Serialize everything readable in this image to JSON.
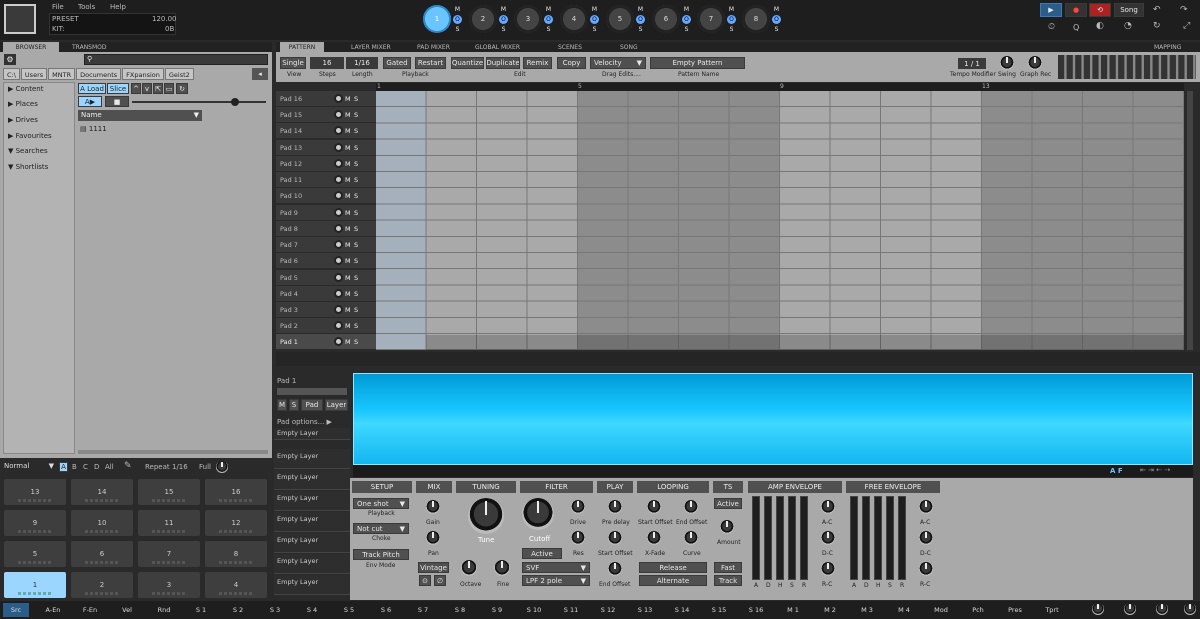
{
  "menu": {
    "file": "File",
    "tools": "Tools",
    "help": "Help"
  },
  "preset": {
    "preset_label": "PRESET",
    "preset_value": "120.00",
    "kit_label": "KIT:",
    "kit_value": "0B"
  },
  "sequences": [
    "1",
    "2",
    "3",
    "4",
    "5",
    "6",
    "7",
    "8"
  ],
  "mos": [
    "M",
    "O",
    "S"
  ],
  "transport": {
    "song": "Song",
    "q": "Q"
  },
  "browser": {
    "tabs": [
      "BROWSER",
      "TRANSMOD"
    ],
    "path": [
      "C:\\",
      "Users",
      "MNTR",
      "Documents",
      "FXpansion",
      "Geist2"
    ],
    "tree": [
      "Content",
      "Places",
      "Drives",
      "Favourites",
      "Searches",
      "Shortlists"
    ],
    "load": "A Load",
    "slice": "Slice",
    "a_btn": "A",
    "name_header": "Name",
    "file": "1111"
  },
  "pad_mode": {
    "mode": "Normal",
    "banks": [
      "A",
      "B",
      "C",
      "D",
      "All"
    ],
    "repeat_label": "Repeat",
    "repeat_value": "1/16",
    "full": "Full"
  },
  "pads": [
    [
      "13",
      "14",
      "15",
      "16"
    ],
    [
      "9",
      "10",
      "11",
      "12"
    ],
    [
      "5",
      "6",
      "7",
      "8"
    ],
    [
      "1",
      "2",
      "3",
      "4"
    ]
  ],
  "main_tabs": [
    "PATTERN",
    "LAYER MIXER",
    "PAD MIXER",
    "GLOBAL MIXER",
    "SCENES",
    "SONG",
    "MAPPING"
  ],
  "toolbar": {
    "single": "Single",
    "steps": "16",
    "length": "1/16",
    "gated": "Gated",
    "restart": "Restart",
    "quantize": "Quantize",
    "duplicate": "Duplicate",
    "remix": "Remix",
    "copy": "Copy",
    "velocity": "Velocity",
    "empty_pattern": "Empty Pattern",
    "tempo_value": "1 / 1",
    "sub_view": "View",
    "sub_steps": "Steps",
    "sub_length": "Length",
    "sub_playback": "Playback",
    "sub_edit": "Edit",
    "sub_drag": "Drag Edits....",
    "sub_pname": "Pattern Name",
    "sub_tempo": "Tempo Modifier",
    "sub_swing": "Swing",
    "sub_graph": "Graph Rec"
  },
  "ruler": [
    "1",
    "5",
    "9",
    "13"
  ],
  "pad_rows": [
    "Pad 16",
    "Pad 15",
    "Pad 14",
    "Pad 13",
    "Pad 12",
    "Pad 11",
    "Pad 10",
    "Pad 9",
    "Pad 8",
    "Pad 7",
    "Pad 6",
    "Pad 5",
    "Pad 4",
    "Pad 3",
    "Pad 2",
    "Pad 1"
  ],
  "pad_row_ms": {
    "m": "M",
    "s": "S"
  },
  "pad_panel": {
    "title": "Pad 1",
    "m": "M",
    "s": "S",
    "pad": "Pad",
    "layer": "Layer",
    "options": "Pad options...",
    "layers": [
      "Empty Layer",
      "Empty Layer",
      "Empty Layer",
      "Empty Layer",
      "Empty Layer",
      "Empty Layer",
      "Empty Layer",
      "Empty Layer"
    ]
  },
  "waveform": {
    "af": "A F"
  },
  "sections": {
    "setup": {
      "title": "SETUP",
      "oneshot": "One shot",
      "playback": "Playback",
      "notcut": "Not cut",
      "choke": "Choke",
      "trackpitch": "Track Pitch",
      "envmode": "Env Mode"
    },
    "mix": {
      "title": "MIX",
      "gain": "Gain",
      "pan": "Pan",
      "vintage": "Vintage"
    },
    "tuning": {
      "title": "TUNING",
      "tune": "Tune",
      "octave": "Octave",
      "fine": "Fine"
    },
    "filter": {
      "title": "FILTER",
      "drive": "Drive",
      "cutoff": "Cutoff",
      "res": "Res",
      "active": "Active",
      "svf": "SVF",
      "lpf": "LPF 2 pole"
    },
    "play": {
      "title": "PLAY",
      "predelay": "Pre delay",
      "startoffset": "Start Offset",
      "endoffset": "End Offset"
    },
    "looping": {
      "title": "LOOPING",
      "startoffset": "Start Offset",
      "endoffset": "End Offset",
      "xfade": "X-Fade",
      "curve": "Curve",
      "release": "Release",
      "alternate": "Alternate"
    },
    "ts": {
      "title": "TS",
      "active": "Active",
      "amount": "Amount",
      "fast": "Fast",
      "track": "Track"
    },
    "amp": {
      "title": "AMP ENVELOPE",
      "ac": "A-C",
      "dc": "D-C",
      "rc": "R-C",
      "letters": [
        "A",
        "D",
        "H",
        "S",
        "R"
      ]
    },
    "free": {
      "title": "FREE ENVELOPE",
      "ac": "A-C",
      "dc": "D-C",
      "rc": "R-C",
      "letters": [
        "A",
        "D",
        "H",
        "S",
        "R"
      ]
    }
  },
  "bottom_tabs": [
    "Src",
    "A-En",
    "F-En",
    "Vel",
    "Rnd",
    "S 1",
    "S 2",
    "S 3",
    "S 4",
    "S 5",
    "S 6",
    "S 7",
    "S 8",
    "S 9",
    "S 10",
    "S 11",
    "S 12",
    "S 13",
    "S 14",
    "S 15",
    "S 16",
    "M 1",
    "M 2",
    "M 3",
    "M 4",
    "Mod",
    "Pch",
    "Pres",
    "Tprt"
  ]
}
